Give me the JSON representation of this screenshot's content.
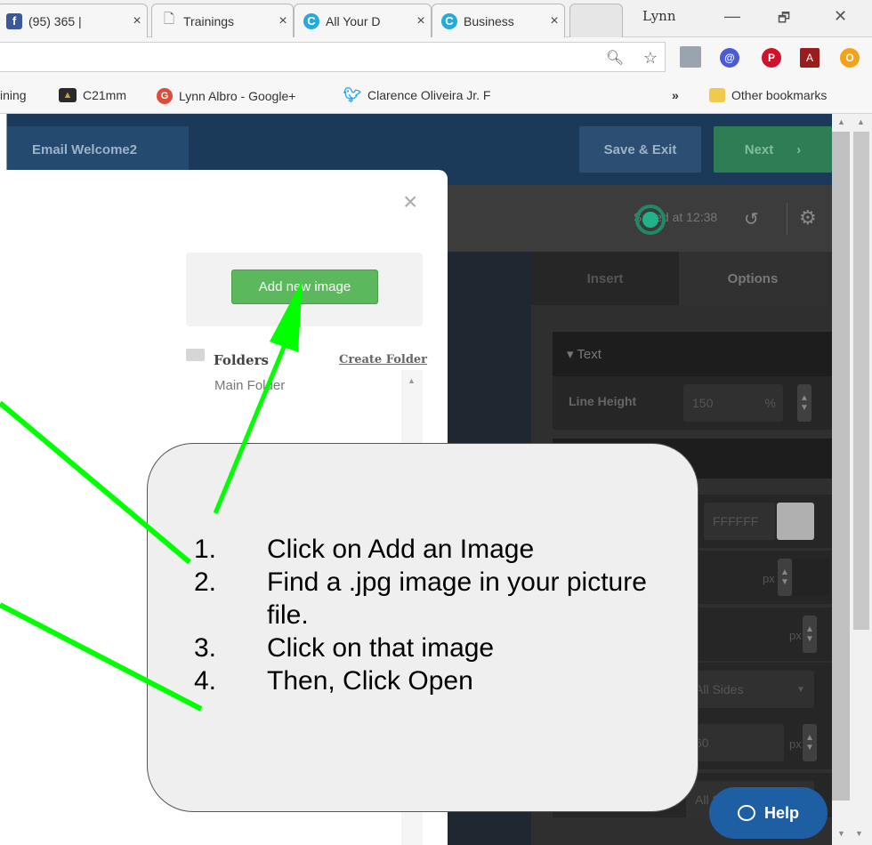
{
  "browser": {
    "tabs": [
      {
        "title": "(95) 365 |",
        "icon": "facebook-icon",
        "color": "#3b5998",
        "glyph": "f"
      },
      {
        "title": "Trainings",
        "icon": "page-icon",
        "color": "#ffffff",
        "glyph": "🗋"
      },
      {
        "title": "All Your D",
        "icon": "constant-contact-icon",
        "color": "#27a9d9",
        "glyph": "C"
      },
      {
        "title": "Business",
        "icon": "constant-contact-icon",
        "color": "#27a9d9",
        "glyph": "C"
      }
    ],
    "close_glyph": "×",
    "profile": "Lynn",
    "window_controls": {
      "minimize": "—",
      "restore": "🗗",
      "close": "✕"
    },
    "bookmarks": [
      {
        "label": "ining",
        "icon": ""
      },
      {
        "label": "C21mm",
        "icon": "c21-icon",
        "color": "#2a2a2a"
      },
      {
        "label": "Lynn Albro - Google+",
        "icon": "google-plus-icon",
        "color": "#dd4b39"
      },
      {
        "label": "Clarence Oliveira Jr. F",
        "icon": "twitter-icon",
        "color": "#1da1f2"
      }
    ],
    "overflow": "»",
    "other_bookmarks": "Other bookmarks"
  },
  "app": {
    "page_tab": "Email Welcome2",
    "save_exit": "Save & Exit",
    "next": "Next",
    "next_chevron": "›",
    "saved_status": "Saved at 12:38",
    "panel": {
      "tab_insert": "Insert",
      "tab_options": "Options",
      "section_text": "▾ Text",
      "line_height_label": "Line Height",
      "line_height_value": "150",
      "line_height_unit": "%",
      "color_value": "FFFFFF",
      "px": "px",
      "all_sides": "All Sides",
      "all_sides_2": "All Si",
      "value_60": "60"
    }
  },
  "modal": {
    "close": "×",
    "add_new_image": "Add new image",
    "folders": "Folders",
    "create_folder": "Create Folder",
    "main_folder": "Main Folder"
  },
  "callout": {
    "steps": [
      {
        "num": "1.",
        "text": "Click on Add an Image"
      },
      {
        "num": "2.",
        "text": "Find a .jpg image in your picture file."
      },
      {
        "num": "3.",
        "text": "Click on that image"
      },
      {
        "num": "4.",
        "text": "Then, Click Open"
      }
    ]
  },
  "help": {
    "label": "Help"
  },
  "colors": {
    "arrow": "#00ff00",
    "accent_green": "#5cb85c",
    "header_navy": "#1b3a5a",
    "help_blue": "#1e5fa3"
  }
}
